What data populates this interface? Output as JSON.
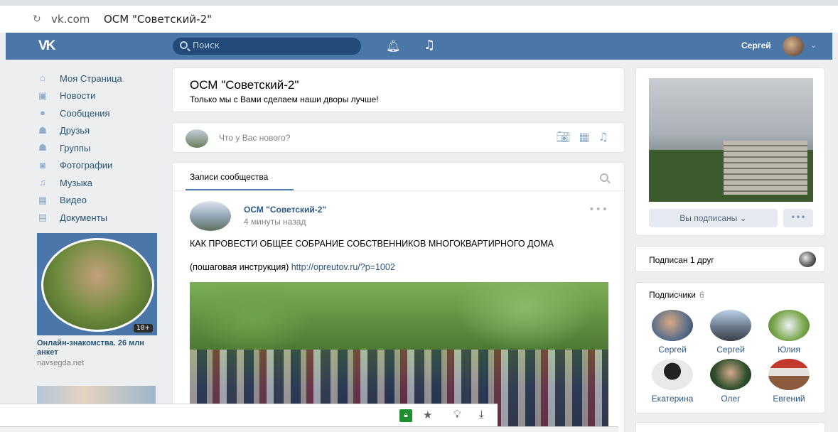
{
  "browser": {
    "reload_icon": "reload-icon",
    "url_host": "vk.com",
    "url_title": "ОСМ \"Советский-2\""
  },
  "header": {
    "logo": "VK",
    "search_placeholder": "Поиск",
    "user_name": "Сергей"
  },
  "left_menu": {
    "items": [
      {
        "icon": "home-icon",
        "glyph": "⌂",
        "label": "Моя Страница"
      },
      {
        "icon": "news-icon",
        "glyph": "▣",
        "label": "Новости"
      },
      {
        "icon": "message-icon",
        "glyph": "●",
        "label": "Сообщения"
      },
      {
        "icon": "friends-icon",
        "glyph": "☗",
        "label": "Друзья"
      },
      {
        "icon": "groups-icon",
        "glyph": "☗",
        "label": "Группы"
      },
      {
        "icon": "photo-icon",
        "glyph": "◙",
        "label": "Фотографии"
      },
      {
        "icon": "music-icon",
        "glyph": "♫",
        "label": "Музыка"
      },
      {
        "icon": "video-icon",
        "glyph": "▦",
        "label": "Видео"
      },
      {
        "icon": "documents-icon",
        "glyph": "▤",
        "label": "Документы"
      }
    ],
    "ad": {
      "badge": "18+",
      "title": "Онлайн-знакомства. 26 млн анкет",
      "url": "navsegda.net"
    }
  },
  "group": {
    "title": "ОСМ \"Советский-2\"",
    "status": "Только мы с Вами сделаем наши дворы лучше!"
  },
  "post_input": {
    "placeholder": "Что у Вас нового?"
  },
  "wall": {
    "tab_label": "Записи сообщества",
    "post": {
      "author": "ОСМ \"Советский-2\"",
      "time": "4 минуты назад",
      "more": "•••",
      "text_line1": "КАК ПРОВЕСТИ ОБЩЕЕ СОБРАНИЕ СОБСТВЕННИКОВ МНОГОКВАРТИРНОГО ДОМА",
      "text_line2_prefix": "(пошаговая инструкция) ",
      "link": "http://opreutov.ru/?p=1002"
    }
  },
  "right": {
    "subscribed_label": "Вы подписаны ⌄",
    "more_label": "•••",
    "friend_text": "Подписан 1 друг",
    "subscribers_label": "Подписчики",
    "subscribers_count": "6",
    "subscribers": [
      {
        "name": "Сергей"
      },
      {
        "name": "Сергей"
      },
      {
        "name": "Юлия"
      },
      {
        "name": "Екатерина"
      },
      {
        "name": "Олег"
      },
      {
        "name": "Евгений"
      }
    ]
  },
  "colors": {
    "header_blue": "#4a76a8",
    "link_blue": "#2a5885",
    "page_bg": "#edeef0"
  }
}
